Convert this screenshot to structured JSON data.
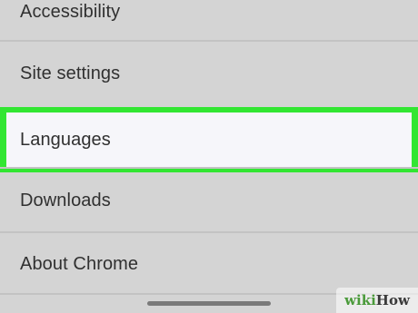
{
  "settings": {
    "items": [
      {
        "label": "Accessibility"
      },
      {
        "label": "Site settings"
      },
      {
        "label": "Languages"
      },
      {
        "label": "Downloads"
      },
      {
        "label": "About Chrome"
      }
    ],
    "highlighted_item": "Languages"
  },
  "watermark": {
    "part1": "wiki",
    "part2": "How"
  },
  "colors": {
    "background": "#d4d4d4",
    "highlight_border": "#32e632",
    "highlight_fill": "#f6f6fa",
    "text": "#303030"
  }
}
